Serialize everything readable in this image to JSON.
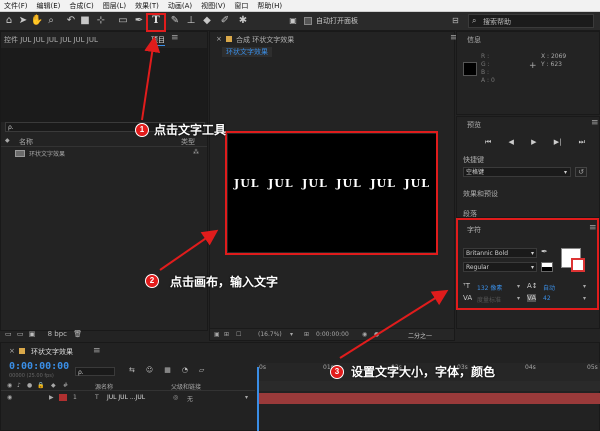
{
  "menu": [
    "文件(F)",
    "编辑(E)",
    "合成(C)",
    "图层(L)",
    "效果(T)",
    "动画(A)",
    "视图(V)",
    "窗口",
    "帮助(H)"
  ],
  "toolbar": {
    "auto_open_panel": "自动打开面板",
    "search_help": "搜索帮助",
    "text_tool_glyph": "T"
  },
  "effects_panel_tab": "控件 JUL JUL JUL JUL JUL JUL",
  "project": {
    "tab": "项目",
    "search_prefix": "ρ.",
    "col_name": "名称",
    "col_type": "类型",
    "item_name": "环状文字效果",
    "bpc": "8 bpc"
  },
  "composition": {
    "tab_prefix": "合成",
    "tab_name": "环状文字效果",
    "sub_tab": "环状文字效果",
    "words": [
      "JUL",
      "JUL",
      "JUL",
      "JUL",
      "JUL",
      "JUL"
    ],
    "zoom": "(16.7%)",
    "time": "0:00:00:00",
    "resolution": "二分之一"
  },
  "info": {
    "title": "信息",
    "r": "R :",
    "g": "G :",
    "b": "B :",
    "a": "A : 0",
    "x": "X : 2069",
    "y": "Y : 623"
  },
  "preview": {
    "title": "预览",
    "shortcut_label": "快捷键",
    "shortcut_value": "空格键"
  },
  "effects_presets": "效果和预设",
  "paragraph": "段落",
  "character": {
    "title": "字符",
    "font": "Britannic Bold",
    "style": "Regular",
    "size": "132 像素",
    "leading": "自动",
    "kerning_label": "度量标准",
    "tracking": "42"
  },
  "timeline": {
    "tab": "环状文字效果",
    "timecode": "0:00:00:00",
    "fps": "00000 (25.00 fps)",
    "col_layer_name": "源名称",
    "col_parent": "父级和链接",
    "layer_num": "1",
    "layer_type": "T",
    "layer_name": "JUL JUL ...JUL",
    "parent_value": "无",
    "ruler": [
      "0s",
      "01s",
      "02s",
      "03s",
      "04s",
      "05s"
    ]
  },
  "annotations": [
    {
      "num": "1",
      "text": "点击文字工具"
    },
    {
      "num": "2",
      "text": "点击画布，输入文字"
    },
    {
      "num": "3",
      "text": "设置文字大小，字体，颜色"
    }
  ],
  "colors": {
    "accent_red": "#e01c1c",
    "timecode_blue": "#3a8ee6",
    "layer_bar": "#9a3a3a"
  }
}
